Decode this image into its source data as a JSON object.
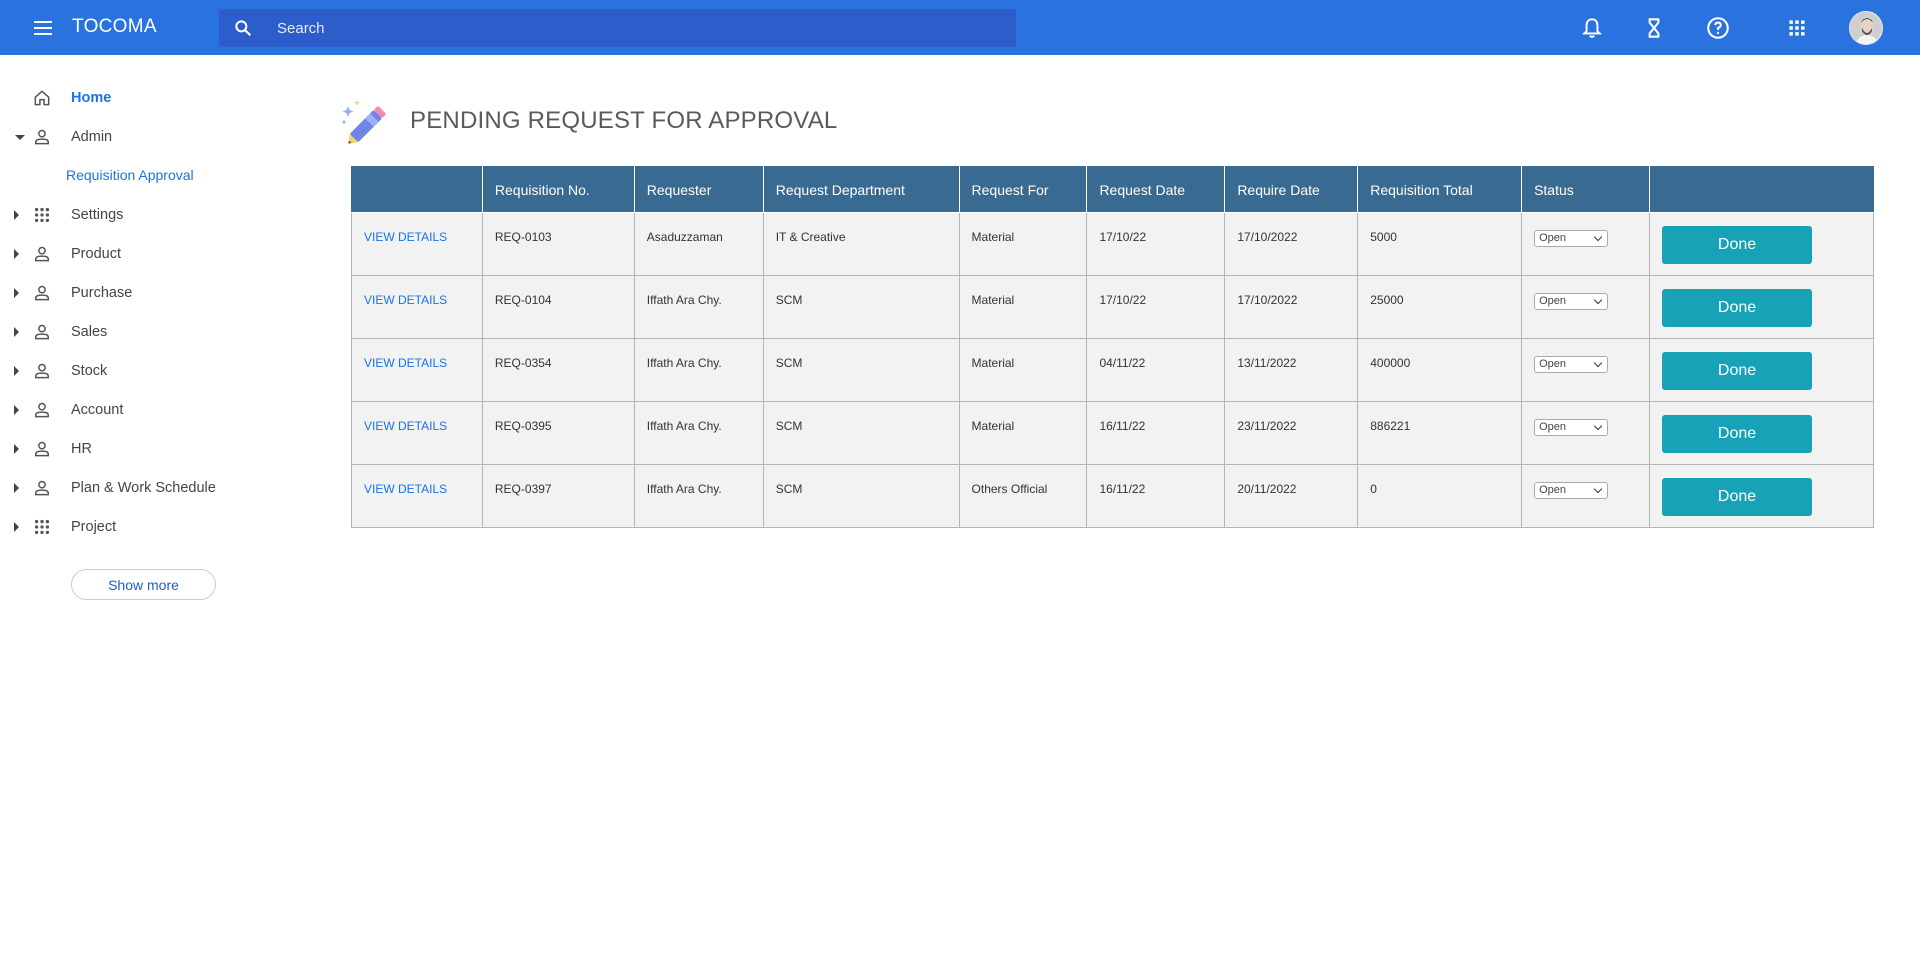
{
  "app": {
    "title": "TOCOMA"
  },
  "search": {
    "placeholder": "Search"
  },
  "colors": {
    "topbar": "#2a72dd",
    "search_bg": "#2d5ccb",
    "table_header": "#386a92",
    "done_button": "#17a2b8",
    "link": "#1a73e8"
  },
  "topbar_icons": [
    "notifications-icon",
    "hourglass-icon",
    "help-icon",
    "apps-grid-icon",
    "user-avatar"
  ],
  "sidebar": {
    "items": [
      {
        "label": "Home",
        "icon": "home-icon",
        "active": true
      },
      {
        "label": "Admin",
        "icon": "person-icon",
        "expanded": true
      },
      {
        "label": "Settings",
        "icon": "grid-icon"
      },
      {
        "label": "Product",
        "icon": "person-icon"
      },
      {
        "label": "Purchase",
        "icon": "person-icon"
      },
      {
        "label": "Sales",
        "icon": "person-icon"
      },
      {
        "label": "Stock",
        "icon": "person-icon"
      },
      {
        "label": "Account",
        "icon": "person-icon"
      },
      {
        "label": "HR",
        "icon": "person-icon"
      },
      {
        "label": "Plan & Work Schedule",
        "icon": "person-icon"
      },
      {
        "label": "Project",
        "icon": "grid-icon"
      }
    ],
    "sub_item": "Requisition Approval",
    "show_more": "Show more"
  },
  "page": {
    "title": "PENDING REQUEST FOR APPROVAL",
    "icon": "pencil-sparkle-icon"
  },
  "table": {
    "headers": [
      "",
      "Requisition No.",
      "Requester",
      "Request Department",
      "Request For",
      "Request Date",
      "Require Date",
      "Requisition Total",
      "Status",
      ""
    ],
    "rows": [
      {
        "link": "VIEW DETAILS",
        "req_no": "REQ-0103",
        "requester": "Asaduzzaman",
        "department": "IT & Creative",
        "request_for": "Material",
        "request_date": "17/10/22",
        "require_date": "17/10/2022",
        "total": "5000",
        "status": "Open",
        "action": "Done"
      },
      {
        "link": "VIEW DETAILS",
        "req_no": "REQ-0104",
        "requester": "Iffath Ara Chy.",
        "department": "SCM",
        "request_for": "Material",
        "request_date": "17/10/22",
        "require_date": "17/10/2022",
        "total": "25000",
        "status": "Open",
        "action": "Done"
      },
      {
        "link": "VIEW DETAILS",
        "req_no": "REQ-0354",
        "requester": "Iffath Ara Chy.",
        "department": "SCM",
        "request_for": "Material",
        "request_date": "04/11/22",
        "require_date": "13/11/2022",
        "total": "400000",
        "status": "Open",
        "action": "Done"
      },
      {
        "link": "VIEW DETAILS",
        "req_no": "REQ-0395",
        "requester": "Iffath Ara Chy.",
        "department": "SCM",
        "request_for": "Material",
        "request_date": "16/11/22",
        "require_date": "23/11/2022",
        "total": "886221",
        "status": "Open",
        "action": "Done"
      },
      {
        "link": "VIEW DETAILS",
        "req_no": "REQ-0397",
        "requester": "Iffath Ara Chy.",
        "department": "SCM",
        "request_for": "Others Official",
        "request_date": "16/11/22",
        "require_date": "20/11/2022",
        "total": "0",
        "status": "Open",
        "action": "Done"
      }
    ]
  }
}
